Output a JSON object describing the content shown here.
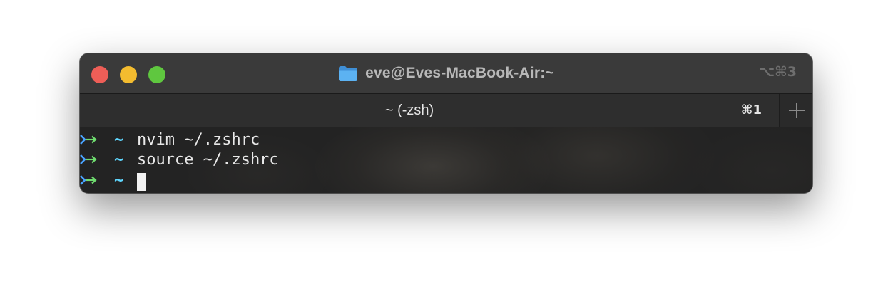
{
  "window": {
    "title": "eve@Eves-MacBook-Air:~",
    "title_shortcut": "⌥⌘3",
    "title_icon": "folder-icon"
  },
  "tabs": [
    {
      "label": "~ (-zsh)",
      "shortcut": "⌘1",
      "active": true
    }
  ],
  "new_tab_icon": "plus-icon",
  "terminal": {
    "prompt_symbol": "~",
    "lines": [
      {
        "cwd": "~",
        "command": "nvim ~/.zshrc"
      },
      {
        "cwd": "~",
        "command": "source ~/.zshrc"
      },
      {
        "cwd": "~",
        "command": ""
      }
    ]
  },
  "colors": {
    "close": "#ee5e57",
    "minimize": "#f3bc2f",
    "zoom": "#5fc73f",
    "prompt_arrow_blue": "#4aa3ff",
    "prompt_arrow_green": "#6fdc6f",
    "cwd_cyan": "#5fd7ff",
    "folder_blue": "#4fa3e8"
  }
}
